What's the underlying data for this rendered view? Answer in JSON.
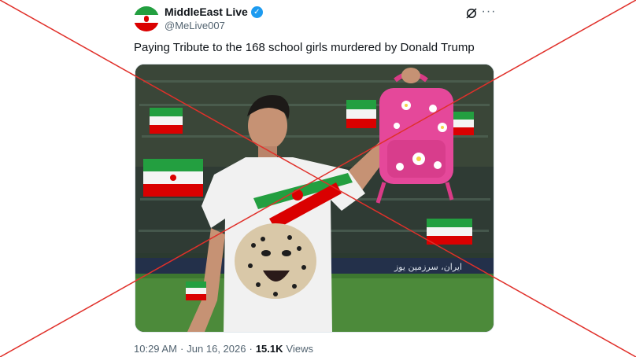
{
  "account": {
    "display_name": "MiddleEast Live",
    "handle": "@MeLive007",
    "verified": true
  },
  "icons": {
    "verified": "verified-badge-icon",
    "grok": "grok-icon",
    "more": "more-options-icon"
  },
  "tweet": {
    "text": "Paying Tribute to the 168 school girls murdered by Donald Trump",
    "media_alt": "Footballer in white jersey with Iranian flag stripes and cheetah print, holding up a pink floral backpack in a stadium with Iranian flags",
    "stadium_banner_text": "ایران، سرزمین یوز"
  },
  "meta": {
    "time": "10:29 AM",
    "separator": "·",
    "date": "Jun 16, 2026",
    "views_count": "15.1K",
    "views_label": "Views"
  },
  "colors": {
    "verified": "#1d9bf0",
    "cross_line": "#e0302a",
    "secondary_text": "#536471"
  }
}
